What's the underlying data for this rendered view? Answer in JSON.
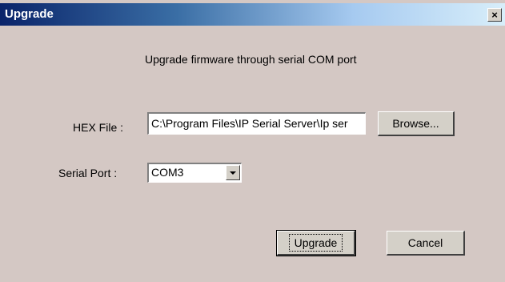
{
  "window": {
    "title": "Upgrade",
    "close_glyph": "×"
  },
  "dialog": {
    "description": "Upgrade firmware through serial COM port",
    "hex_file_label": "HEX File :",
    "hex_file_value": "C:\\Program Files\\IP Serial Server\\Ip ser",
    "browse_label": "Browse...",
    "serial_port_label": "Serial Port :",
    "serial_port_value": "COM3",
    "upgrade_label": "Upgrade",
    "cancel_label": "Cancel"
  },
  "icons": {
    "close": "close-icon",
    "dropdown": "chevron-down-icon"
  },
  "colors": {
    "dialog_background": "#d4c8c4",
    "titlebar_start": "#0a246a",
    "titlebar_end": "#d8eefa"
  }
}
